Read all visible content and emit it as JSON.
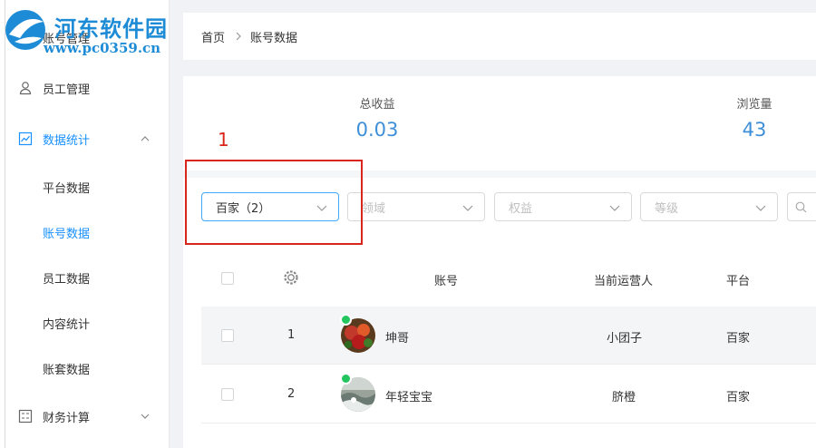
{
  "watermark": {
    "title": "河东软件园",
    "url": "www.pc0359.cn"
  },
  "sidebar": {
    "items": [
      {
        "label": "账号管理",
        "icon": "user-icon"
      },
      {
        "label": "员工管理",
        "icon": "user-icon"
      },
      {
        "label": "数据统计",
        "icon": "chart-icon",
        "expanded": true
      },
      {
        "label": "财务计算",
        "icon": "calculator-icon"
      }
    ],
    "subitems": [
      {
        "label": "平台数据"
      },
      {
        "label": "账号数据"
      },
      {
        "label": "员工数据"
      },
      {
        "label": "内容统计"
      },
      {
        "label": "账套数据"
      }
    ]
  },
  "breadcrumb": {
    "home": "首页",
    "current": "账号数据"
  },
  "stats": [
    {
      "title": "总收益",
      "value": "0.03"
    },
    {
      "title": "浏览量",
      "value": "43"
    }
  ],
  "annotation": {
    "number": "1"
  },
  "filters": [
    {
      "value": "百家（2）",
      "placeholder": ""
    },
    {
      "value": "",
      "placeholder": "领域"
    },
    {
      "value": "",
      "placeholder": "权益"
    },
    {
      "value": "",
      "placeholder": "等级"
    }
  ],
  "table": {
    "headers": [
      "账号",
      "当前运营人",
      "平台"
    ],
    "rows": [
      {
        "index": "1",
        "account": "坤哥",
        "operator": "小团子",
        "platform": "百家"
      },
      {
        "index": "2",
        "account": "年轻宝宝",
        "operator": "脐橙",
        "platform": "百家"
      }
    ]
  },
  "colors": {
    "accent": "#1890ff",
    "value": "#3e8fd8",
    "annotation": "#d9261c",
    "online": "#22c55e"
  }
}
